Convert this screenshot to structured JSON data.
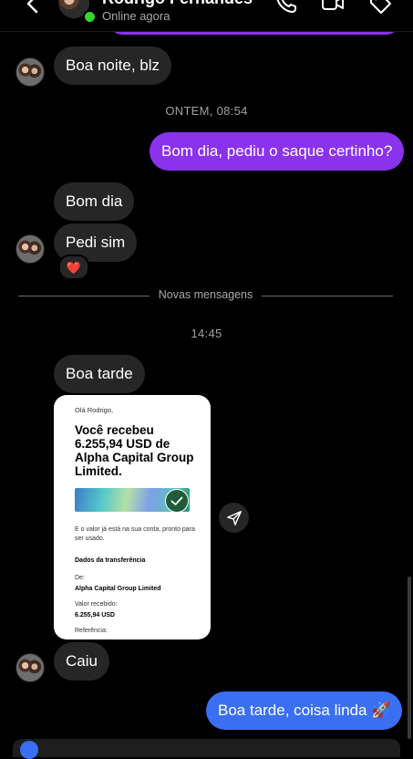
{
  "header": {
    "contact_name": "Rodrigo Fernandes",
    "status": "Online agora",
    "icons": [
      "back-chevron-icon",
      "phone-icon",
      "video-icon",
      "tag-icon"
    ]
  },
  "messages": {
    "m1": "Boa noite, blz",
    "ts1": "ONTEM, 08:54",
    "m2": "Bom dia, pediu o saque certinho?",
    "m3": "Bom dia",
    "m4": "Pedi sim",
    "reaction": "❤️",
    "divider": "Novas mensagens",
    "ts2": "14:45",
    "m5": "Boa tarde",
    "m6": "Caiu",
    "m7": "Boa tarde, coisa linda 🚀"
  },
  "receipt": {
    "greeting": "Olá Rodrigo,",
    "headline": "Você recebeu 6.255,94 USD de Alpha Capital Group Limited.",
    "available": "E o valor já está na sua conta, pronto para ser usado.",
    "section_title": "Dados da transferência",
    "from_label": "De:",
    "from_value": "Alpha Capital Group Limited",
    "received_label": "Valor recebido:",
    "received_value": "6.255,94 USD",
    "reference_label": "Referência:"
  },
  "colors": {
    "outgoing_purple": "#8a32ec",
    "outgoing_blue": "#3a6ff2",
    "incoming": "#262626",
    "online": "#38d430"
  }
}
